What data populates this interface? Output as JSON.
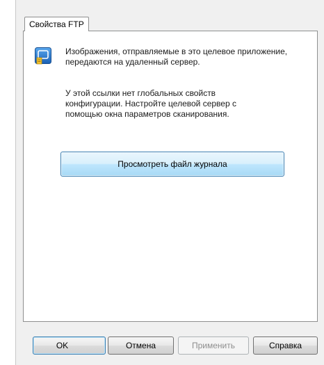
{
  "tab": {
    "label": "Свойства FTP"
  },
  "panel": {
    "icon": "ftp-destination-icon",
    "description": "Изображения, отправляемые в это целевое приложение, передаются на удаленный сервер.",
    "config_note": "У этой ссылки нет глобальных свойств конфигурации. Настройте целевой сервер с помощью окна параметров сканирования.",
    "view_log_button": "Просмотреть файл журнала"
  },
  "footer": {
    "ok_label": "OK",
    "cancel_label": "Отмена",
    "apply_label": "Применить",
    "help_label": "Справка"
  },
  "colors": {
    "dialog_background": "#f0f0f0",
    "panel_background": "#ffffff",
    "focus_border": "#3c7fb1",
    "disabled_text": "#8d8d8d",
    "icon_blue": "#1f6fc4",
    "icon_yellow": "#f2c12e"
  }
}
